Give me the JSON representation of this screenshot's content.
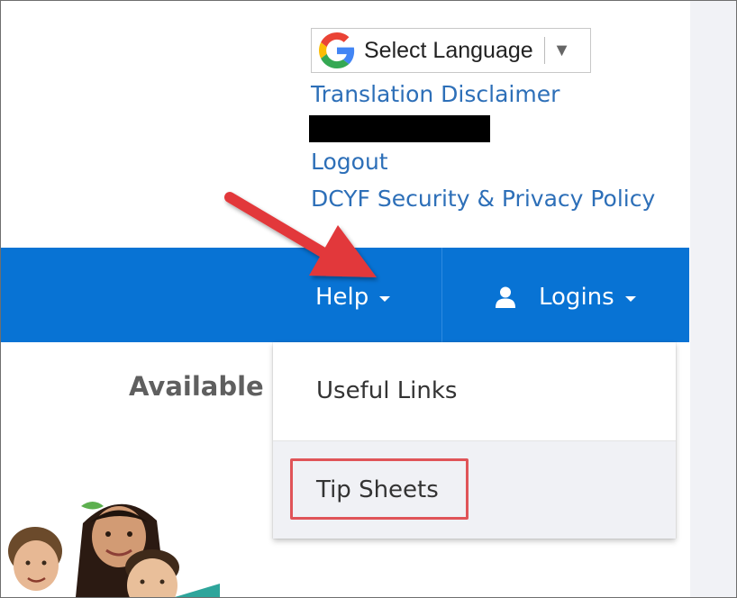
{
  "translate": {
    "label": "Select Language",
    "arrow": "▼",
    "icon": "google-g-icon"
  },
  "top_links": {
    "translation_disclaimer": "Translation Disclaimer",
    "logout": "Logout",
    "privacy_policy": "DCYF Security & Privacy Policy"
  },
  "nav": {
    "help_label": "Help",
    "logins_label": "Logins",
    "logins_icon": "user-icon",
    "bar_color": "#0873d4"
  },
  "background": {
    "heading_partial": "Available A"
  },
  "help_menu": {
    "items": [
      {
        "label": "Useful Links"
      },
      {
        "label": "Tip Sheets"
      }
    ]
  },
  "annotations": {
    "arrow_color": "#e2393b",
    "highlight_color": "#e05458"
  }
}
